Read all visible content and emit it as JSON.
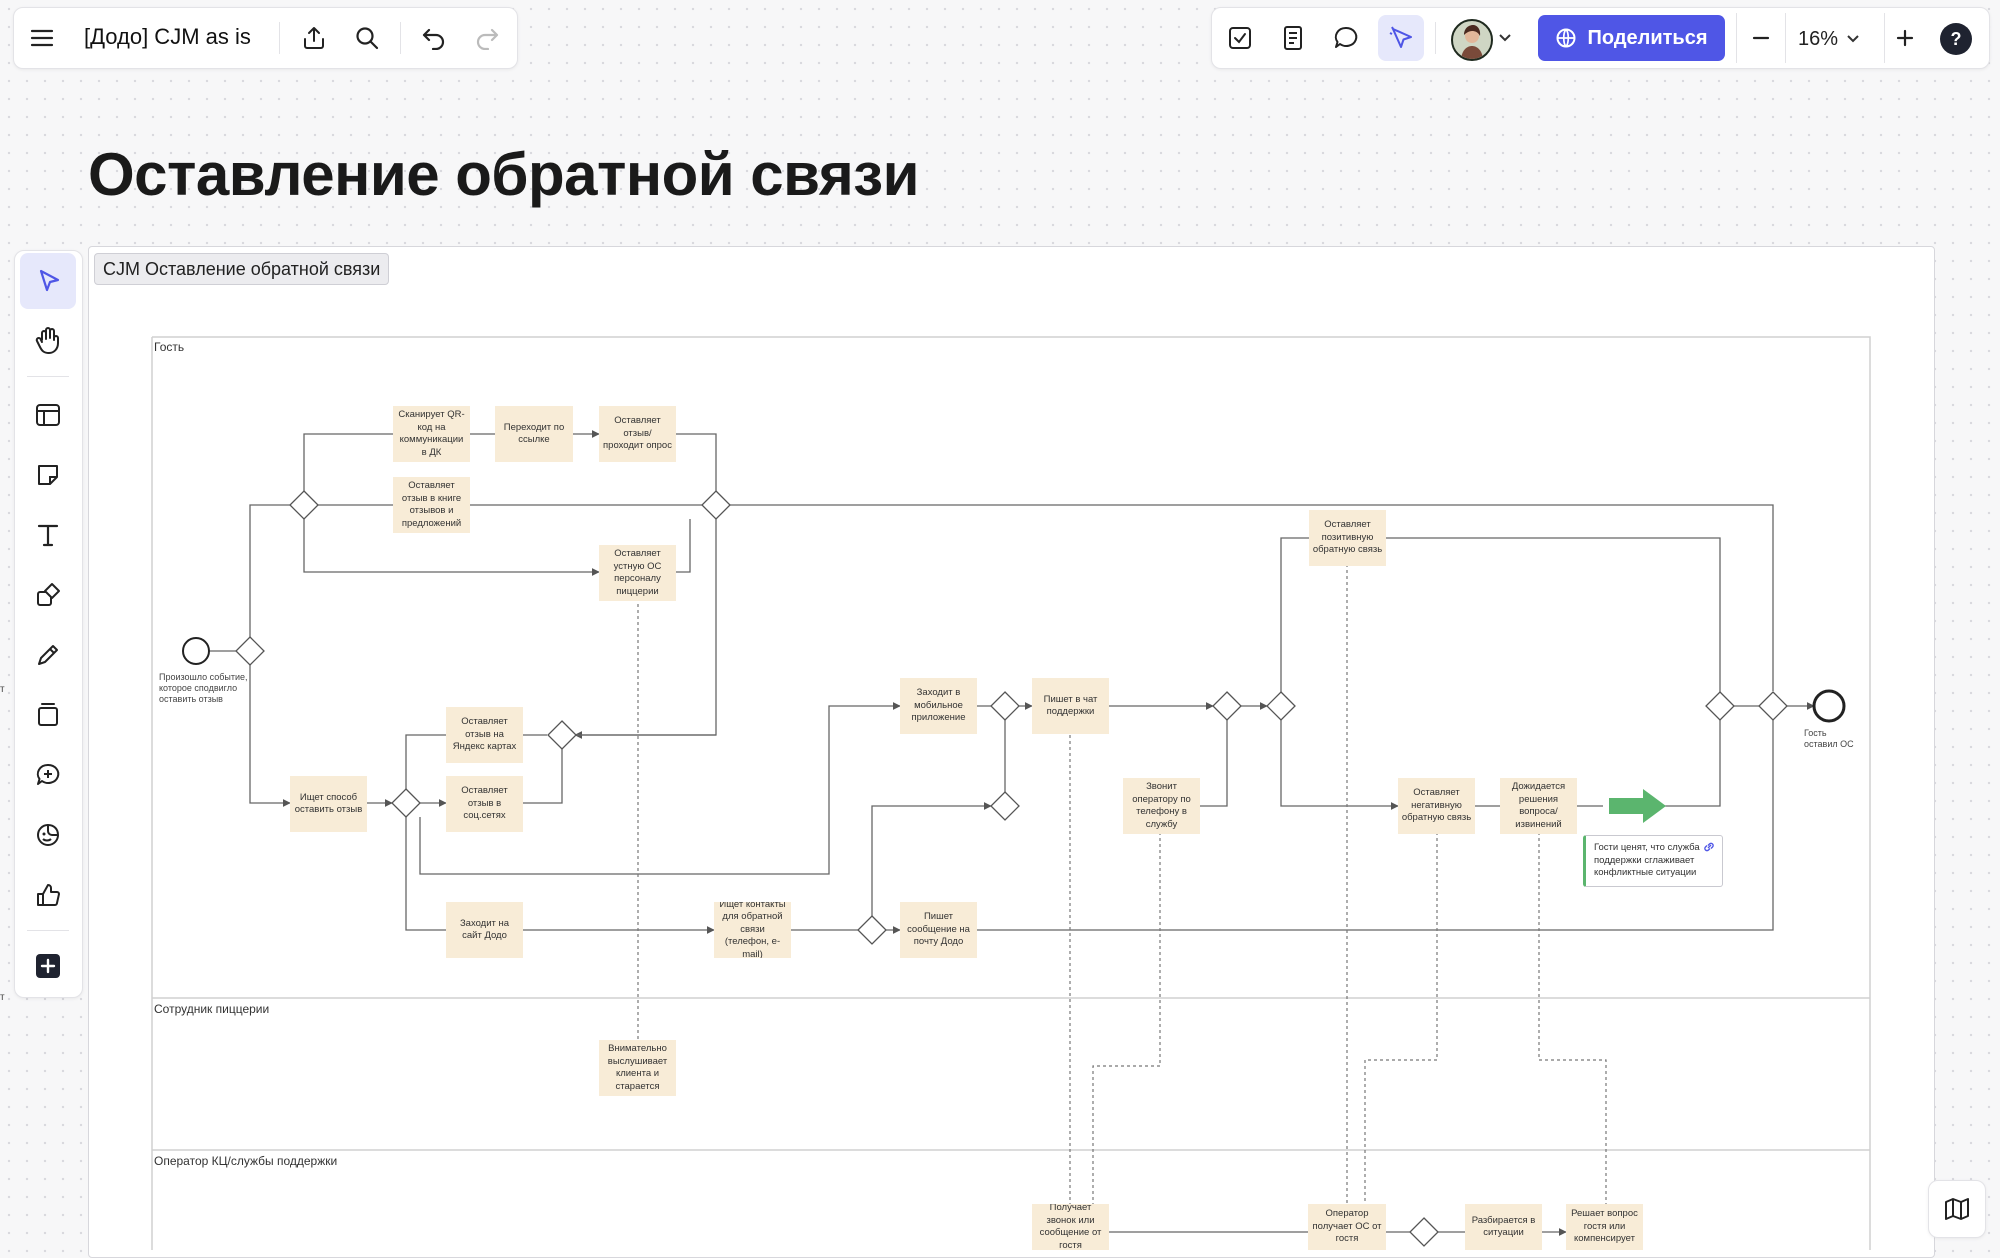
{
  "header": {
    "board_name": "[Додо] CJM as is",
    "share_label": "Поделиться",
    "zoom_label": "16%",
    "help_label": "?"
  },
  "board": {
    "title": "Оставление обратной связи",
    "frame_label": "CJM Оставление обратной связи"
  },
  "lanes": [
    "Гость",
    "Сотрудник пиццерии",
    "Оператор КЦ/службы поддержки"
  ],
  "nodes": {
    "scan_qr": "Сканирует QR-код на коммуникации в ДК",
    "follow_link": "Переходит по ссылке",
    "leave_review_poll": "Оставляет отзыв/ проходит опрос",
    "review_book": "Оставляет отзыв в книге отзывов и предложений",
    "oral_feedback": "Оставляет устную ОС персоналу пиццерии",
    "start_event": "Произошло событие, которое сподвигло оставить отзыв",
    "yandex_maps": "Оставляет отзыв на Яндекс картах",
    "social": "Оставляет отзыв в соц.сетях",
    "find_way": "Ищет способ оставить отзыв",
    "visit_site": "Заходит на сайт Додо",
    "find_contacts": "Ищет контакты для обратной связи (телефон, e-mail)",
    "mobile_app": "Заходит в мобильное приложение",
    "chat_support": "Пишет в чат поддержки",
    "call_operator": "Звонит оператору по телефону в службу",
    "email_message": "Пишет сообщение на почту Додо",
    "positive_feedback": "Оставляет позитивную обратную связь",
    "negative_feedback": "Оставляет негативную обратную связь",
    "wait_resolution": "Дожидается решения вопроса/извинений",
    "end_event": "Гость оставил ОС",
    "staff_listen": "Внимательно выслушивает клиента и старается",
    "op_receive_call": "Получает звонок или сообщение от гостя",
    "op_receive_feedback": "Оператор получает ОС от гостя",
    "op_investigate": "Разбирается в ситуации",
    "op_resolve": "Решает вопрос гостя или компенсирует"
  },
  "comment_note": "Гости ценят, что служба поддержки сглаживает конфликтные ситуации",
  "colors": {
    "accent": "#4f56e6",
    "node_fill": "#f8ecd7",
    "arrow_green": "#5bb56e",
    "active_tool_bg": "#e6e8fb"
  },
  "toolbar_icons": [
    "select-tool",
    "hand-tool",
    "template-tool",
    "sticky-note-tool",
    "text-tool",
    "shapes-tool",
    "pen-tool",
    "frame-tool",
    "comment-add-tool",
    "emoji-tool",
    "reaction-tool",
    "more-tools"
  ]
}
